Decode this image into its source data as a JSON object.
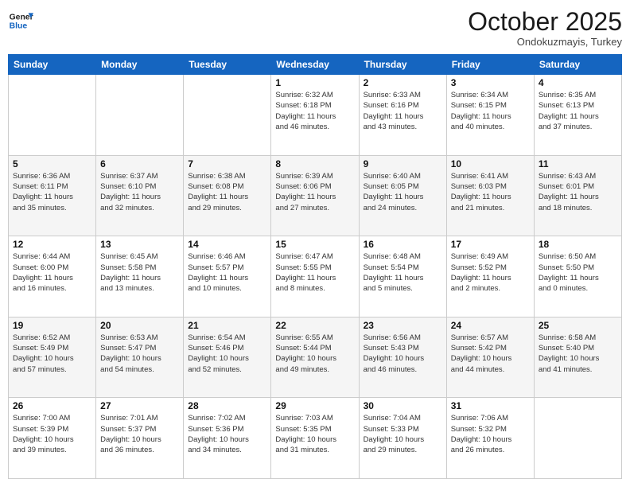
{
  "header": {
    "logo_line1": "General",
    "logo_line2": "Blue",
    "month": "October 2025",
    "location": "Ondokuzmayis, Turkey"
  },
  "days_of_week": [
    "Sunday",
    "Monday",
    "Tuesday",
    "Wednesday",
    "Thursday",
    "Friday",
    "Saturday"
  ],
  "weeks": [
    [
      {
        "day": "",
        "info": ""
      },
      {
        "day": "",
        "info": ""
      },
      {
        "day": "",
        "info": ""
      },
      {
        "day": "1",
        "info": "Sunrise: 6:32 AM\nSunset: 6:18 PM\nDaylight: 11 hours\nand 46 minutes."
      },
      {
        "day": "2",
        "info": "Sunrise: 6:33 AM\nSunset: 6:16 PM\nDaylight: 11 hours\nand 43 minutes."
      },
      {
        "day": "3",
        "info": "Sunrise: 6:34 AM\nSunset: 6:15 PM\nDaylight: 11 hours\nand 40 minutes."
      },
      {
        "day": "4",
        "info": "Sunrise: 6:35 AM\nSunset: 6:13 PM\nDaylight: 11 hours\nand 37 minutes."
      }
    ],
    [
      {
        "day": "5",
        "info": "Sunrise: 6:36 AM\nSunset: 6:11 PM\nDaylight: 11 hours\nand 35 minutes."
      },
      {
        "day": "6",
        "info": "Sunrise: 6:37 AM\nSunset: 6:10 PM\nDaylight: 11 hours\nand 32 minutes."
      },
      {
        "day": "7",
        "info": "Sunrise: 6:38 AM\nSunset: 6:08 PM\nDaylight: 11 hours\nand 29 minutes."
      },
      {
        "day": "8",
        "info": "Sunrise: 6:39 AM\nSunset: 6:06 PM\nDaylight: 11 hours\nand 27 minutes."
      },
      {
        "day": "9",
        "info": "Sunrise: 6:40 AM\nSunset: 6:05 PM\nDaylight: 11 hours\nand 24 minutes."
      },
      {
        "day": "10",
        "info": "Sunrise: 6:41 AM\nSunset: 6:03 PM\nDaylight: 11 hours\nand 21 minutes."
      },
      {
        "day": "11",
        "info": "Sunrise: 6:43 AM\nSunset: 6:01 PM\nDaylight: 11 hours\nand 18 minutes."
      }
    ],
    [
      {
        "day": "12",
        "info": "Sunrise: 6:44 AM\nSunset: 6:00 PM\nDaylight: 11 hours\nand 16 minutes."
      },
      {
        "day": "13",
        "info": "Sunrise: 6:45 AM\nSunset: 5:58 PM\nDaylight: 11 hours\nand 13 minutes."
      },
      {
        "day": "14",
        "info": "Sunrise: 6:46 AM\nSunset: 5:57 PM\nDaylight: 11 hours\nand 10 minutes."
      },
      {
        "day": "15",
        "info": "Sunrise: 6:47 AM\nSunset: 5:55 PM\nDaylight: 11 hours\nand 8 minutes."
      },
      {
        "day": "16",
        "info": "Sunrise: 6:48 AM\nSunset: 5:54 PM\nDaylight: 11 hours\nand 5 minutes."
      },
      {
        "day": "17",
        "info": "Sunrise: 6:49 AM\nSunset: 5:52 PM\nDaylight: 11 hours\nand 2 minutes."
      },
      {
        "day": "18",
        "info": "Sunrise: 6:50 AM\nSunset: 5:50 PM\nDaylight: 11 hours\nand 0 minutes."
      }
    ],
    [
      {
        "day": "19",
        "info": "Sunrise: 6:52 AM\nSunset: 5:49 PM\nDaylight: 10 hours\nand 57 minutes."
      },
      {
        "day": "20",
        "info": "Sunrise: 6:53 AM\nSunset: 5:47 PM\nDaylight: 10 hours\nand 54 minutes."
      },
      {
        "day": "21",
        "info": "Sunrise: 6:54 AM\nSunset: 5:46 PM\nDaylight: 10 hours\nand 52 minutes."
      },
      {
        "day": "22",
        "info": "Sunrise: 6:55 AM\nSunset: 5:44 PM\nDaylight: 10 hours\nand 49 minutes."
      },
      {
        "day": "23",
        "info": "Sunrise: 6:56 AM\nSunset: 5:43 PM\nDaylight: 10 hours\nand 46 minutes."
      },
      {
        "day": "24",
        "info": "Sunrise: 6:57 AM\nSunset: 5:42 PM\nDaylight: 10 hours\nand 44 minutes."
      },
      {
        "day": "25",
        "info": "Sunrise: 6:58 AM\nSunset: 5:40 PM\nDaylight: 10 hours\nand 41 minutes."
      }
    ],
    [
      {
        "day": "26",
        "info": "Sunrise: 7:00 AM\nSunset: 5:39 PM\nDaylight: 10 hours\nand 39 minutes."
      },
      {
        "day": "27",
        "info": "Sunrise: 7:01 AM\nSunset: 5:37 PM\nDaylight: 10 hours\nand 36 minutes."
      },
      {
        "day": "28",
        "info": "Sunrise: 7:02 AM\nSunset: 5:36 PM\nDaylight: 10 hours\nand 34 minutes."
      },
      {
        "day": "29",
        "info": "Sunrise: 7:03 AM\nSunset: 5:35 PM\nDaylight: 10 hours\nand 31 minutes."
      },
      {
        "day": "30",
        "info": "Sunrise: 7:04 AM\nSunset: 5:33 PM\nDaylight: 10 hours\nand 29 minutes."
      },
      {
        "day": "31",
        "info": "Sunrise: 7:06 AM\nSunset: 5:32 PM\nDaylight: 10 hours\nand 26 minutes."
      },
      {
        "day": "",
        "info": ""
      }
    ]
  ],
  "row_shading": [
    "white",
    "shade",
    "white",
    "shade",
    "white"
  ]
}
